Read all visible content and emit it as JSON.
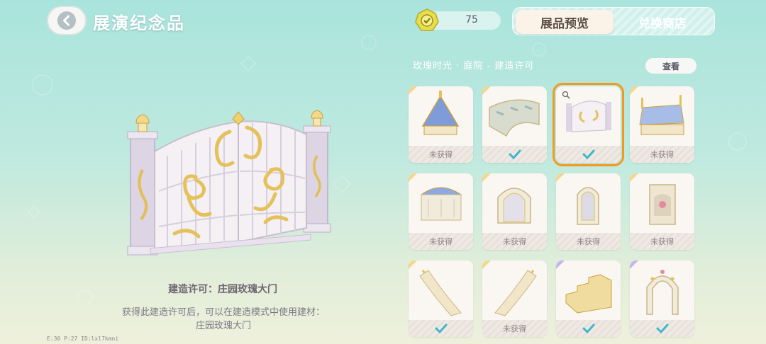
{
  "header": {
    "title": "展演纪念品",
    "back_icon": "chevron-left-icon",
    "currency_icon": "coin-icon",
    "currency_value": "75",
    "tabs": [
      {
        "label": "展品预览",
        "active": true
      },
      {
        "label": "兑换商店",
        "active": false
      }
    ]
  },
  "preview": {
    "item_name": "建造许可：庄园玫瑰大门",
    "description_line1": "获得此建造许可后，可以在建造模式中使用建材：",
    "description_line2": "庄园玫瑰大门",
    "debug_text": "E:30   P:27   ID:lxl7kmni"
  },
  "collection": {
    "title": "玫瑰时光 · 庭院 - 建造许可",
    "view_label": "查看",
    "items": [
      {
        "name": "pavilion-roof",
        "status": "未获得",
        "obtained": false,
        "selected": false,
        "rarity": "gold"
      },
      {
        "name": "garden-floor",
        "status": "",
        "obtained": true,
        "selected": false,
        "rarity": "gold"
      },
      {
        "name": "rose-gate",
        "status": "",
        "obtained": true,
        "selected": true,
        "rarity": "gold"
      },
      {
        "name": "blue-canopy-bed",
        "status": "未获得",
        "obtained": false,
        "selected": false,
        "rarity": "gold"
      },
      {
        "name": "domed-cabinet",
        "status": "未获得",
        "obtained": false,
        "selected": false,
        "rarity": "gold"
      },
      {
        "name": "arched-window-wall",
        "status": "未获得",
        "obtained": false,
        "selected": false,
        "rarity": "gold"
      },
      {
        "name": "arched-mirror",
        "status": "未获得",
        "obtained": false,
        "selected": false,
        "rarity": "gold"
      },
      {
        "name": "rose-niche-pillar",
        "status": "未获得",
        "obtained": false,
        "selected": false,
        "rarity": "gold"
      },
      {
        "name": "curved-staircase-left",
        "status": "",
        "obtained": true,
        "selected": false,
        "rarity": "gold"
      },
      {
        "name": "curved-staircase-right",
        "status": "未获得",
        "obtained": false,
        "selected": false,
        "rarity": "gold"
      },
      {
        "name": "golden-steps",
        "status": "",
        "obtained": true,
        "selected": false,
        "rarity": "purple"
      },
      {
        "name": "rose-arch",
        "status": "",
        "obtained": true,
        "selected": false,
        "rarity": "purple"
      }
    ]
  },
  "colors": {
    "accent_selected": "#f39a1c",
    "check_color": "#3fb8c9",
    "gold_trim": "#e7c25a"
  }
}
